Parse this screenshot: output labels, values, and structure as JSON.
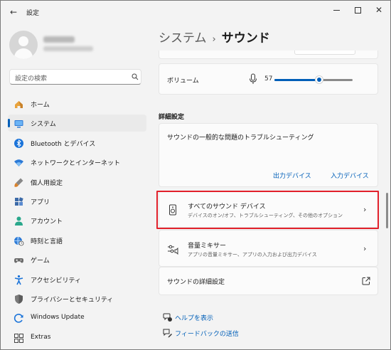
{
  "window": {
    "title": "設定",
    "back_glyph": "←",
    "minimize_label": "",
    "close_glyph": "✕"
  },
  "user": {},
  "search": {
    "placeholder": "設定の検索"
  },
  "nav": {
    "items": [
      {
        "label": "ホーム",
        "icon": "home-icon",
        "selected": false
      },
      {
        "label": "システム",
        "icon": "system-icon",
        "selected": true
      },
      {
        "label": "Bluetooth とデバイス",
        "icon": "bluetooth-icon",
        "selected": false
      },
      {
        "label": "ネットワークとインターネット",
        "icon": "wifi-icon",
        "selected": false
      },
      {
        "label": "個人用設定",
        "icon": "brush-icon",
        "selected": false
      },
      {
        "label": "アプリ",
        "icon": "apps-icon",
        "selected": false
      },
      {
        "label": "アカウント",
        "icon": "account-icon",
        "selected": false
      },
      {
        "label": "時刻と言語",
        "icon": "globe-clock-icon",
        "selected": false
      },
      {
        "label": "ゲーム",
        "icon": "gamepad-icon",
        "selected": false
      },
      {
        "label": "アクセシビリティ",
        "icon": "accessibility-icon",
        "selected": false
      },
      {
        "label": "プライバシーとセキュリティ",
        "icon": "shield-icon",
        "selected": false
      },
      {
        "label": "Windows Update",
        "icon": "update-icon",
        "selected": false
      },
      {
        "label": "Extras",
        "icon": "extras-icon",
        "selected": false
      }
    ]
  },
  "breadcrumb": {
    "parent": "システム",
    "separator": "›",
    "current": "サウンド"
  },
  "volume": {
    "label": "ボリューム",
    "value": "57",
    "level": 0.57,
    "accent": "#005fb8"
  },
  "advanced": {
    "heading": "詳細設定",
    "troubleshoot_title": "サウンドの一般的な問題のトラブルシューティング",
    "output_devices": "出力デバイス",
    "input_devices": "入力デバイス",
    "all_devices_title": "すべてのサウンド デバイス",
    "all_devices_sub": "デバイスのオン/オフ、トラブルシューティング、その他のオプション",
    "mixer_title": "音量ミキサー",
    "mixer_sub": "アプリの音量ミキサー、アプリの入力および出力デバイス",
    "more_settings": "サウンドの詳細設定",
    "chevron": "›"
  },
  "help": {
    "get_help": "ヘルプを表示",
    "feedback": "フィードバックの送信"
  },
  "colors": {
    "highlight": "#e2212b",
    "link": "#005fb8"
  }
}
